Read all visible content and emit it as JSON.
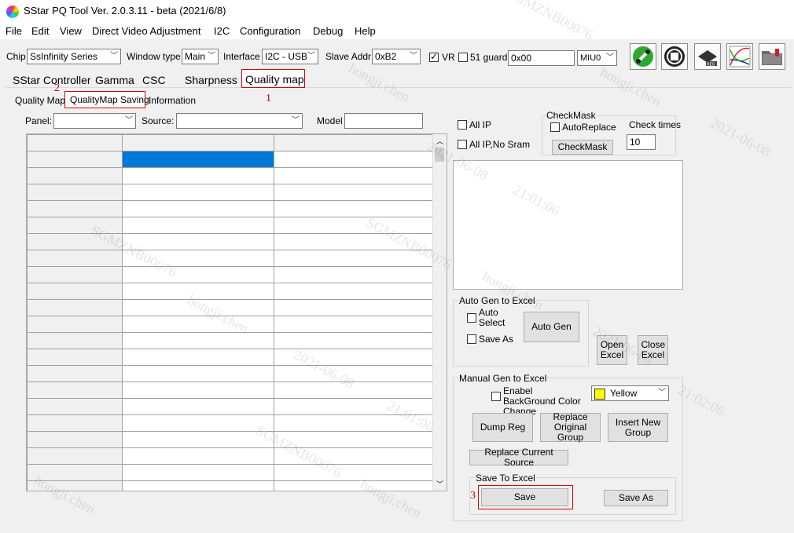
{
  "window": {
    "title": "SStar PQ Tool Ver. 2.0.3.11 - beta (2021/6/8)"
  },
  "menu": [
    "File",
    "Edit",
    "View",
    "Direct Video Adjustment",
    "I2C",
    "Configuration",
    "Debug",
    "Help"
  ],
  "toolbar": {
    "chip_label": "Chip",
    "chip_value": "SsInfinity Series",
    "window_type_label": "Window type",
    "window_type_value": "Main",
    "interface_label": "Interface",
    "interface_value": "I2C - USB",
    "slave_addr_label": "Slave Addr",
    "slave_addr_value": "0xB2",
    "vr_label": "VR",
    "vr_checked": true,
    "guard_label": "51 guard",
    "guard_checked": false,
    "address_value": "0x00",
    "miu_value": "MIU0",
    "icons": [
      "connect-icon",
      "stop-icon",
      "register-icon",
      "curve-icon",
      "folder-icon"
    ]
  },
  "tabs": [
    "SStar Controller",
    "Gamma",
    "CSC",
    "Sharpness",
    "Quality map"
  ],
  "subtabs": [
    "Quality Map",
    "QualityMap Saving",
    "Information"
  ],
  "annotations": {
    "one": "1",
    "two": "2",
    "three": "3"
  },
  "filters": {
    "panel_label": "Panel:",
    "panel_value": "",
    "source_label": "Source:",
    "source_value": "",
    "model_label": "Model",
    "model_value": ""
  },
  "options": {
    "all_ip_label": "All IP",
    "all_ip_nosram_label": "All IP,No Sram",
    "checkmask_title": "CheckMask",
    "autoreplace_label": "AutoReplace",
    "check_times_label": "Check times",
    "check_times_value": "10",
    "checkmask_button": "CheckMask"
  },
  "auto_gen": {
    "title": "Auto Gen to Excel",
    "auto_select": "Auto Select",
    "save_as": "Save As",
    "auto_gen_button": "Auto Gen",
    "open_excel": "Open Excel",
    "close_excel": "Close Excel"
  },
  "manual_gen": {
    "title": "Manual Gen to Excel",
    "bg_change_label": "Enabel BackGround Color Change",
    "color_value": "Yellow",
    "color_swatch": "#ffff00",
    "dump_reg": "Dump Reg",
    "replace_original": "Replace Original Group",
    "insert_new": "Insert New Group",
    "replace_current": "Replace Current Source",
    "save_to_excel_title": "Save To Excel",
    "save": "Save",
    "save_as": "Save As"
  },
  "watermark": {
    "a": "SGMZNB00076",
    "b": "hongji.chen",
    "c": "2021-06-08",
    "d": "21:01:06",
    "e": "21:02:06"
  },
  "colors": {
    "annotation": "#cc0000",
    "selection": "#0078d7"
  }
}
